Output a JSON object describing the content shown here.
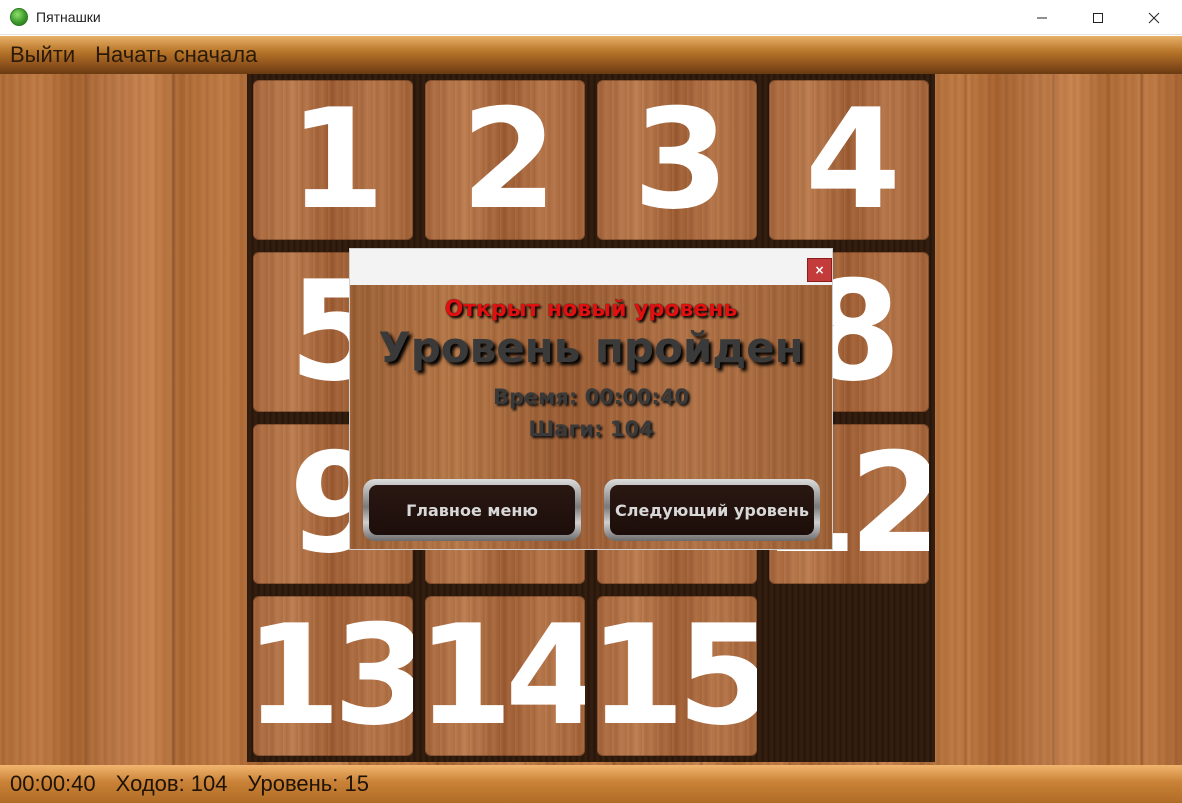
{
  "window": {
    "title": "Пятнашки",
    "controls": {
      "minimize": "—",
      "maximize": "☐",
      "close": "✕"
    }
  },
  "menu": {
    "exit": "Выйти",
    "restart": "Начать сначала"
  },
  "board": {
    "tiles": [
      "1",
      "2",
      "3",
      "4",
      "5",
      "",
      "",
      "8",
      "9",
      "",
      "",
      "12",
      "13",
      "14",
      "15"
    ]
  },
  "dialog": {
    "close": "×",
    "subtitle": "Открыт новый уровень",
    "title": "Уровень пройден",
    "time_line": "Время: 00:00:40",
    "steps_line": "Шаги: 104",
    "main_menu_button": "Главное меню",
    "next_level_button": "Следующий уровень"
  },
  "status": {
    "timer": "00:00:40",
    "moves": "Ходов: 104",
    "level": "Уровень: 15"
  },
  "colors": {
    "dialog_subtitle": "#e01010",
    "tile_text": "#ffffff",
    "board_dark": "#2a1810"
  }
}
